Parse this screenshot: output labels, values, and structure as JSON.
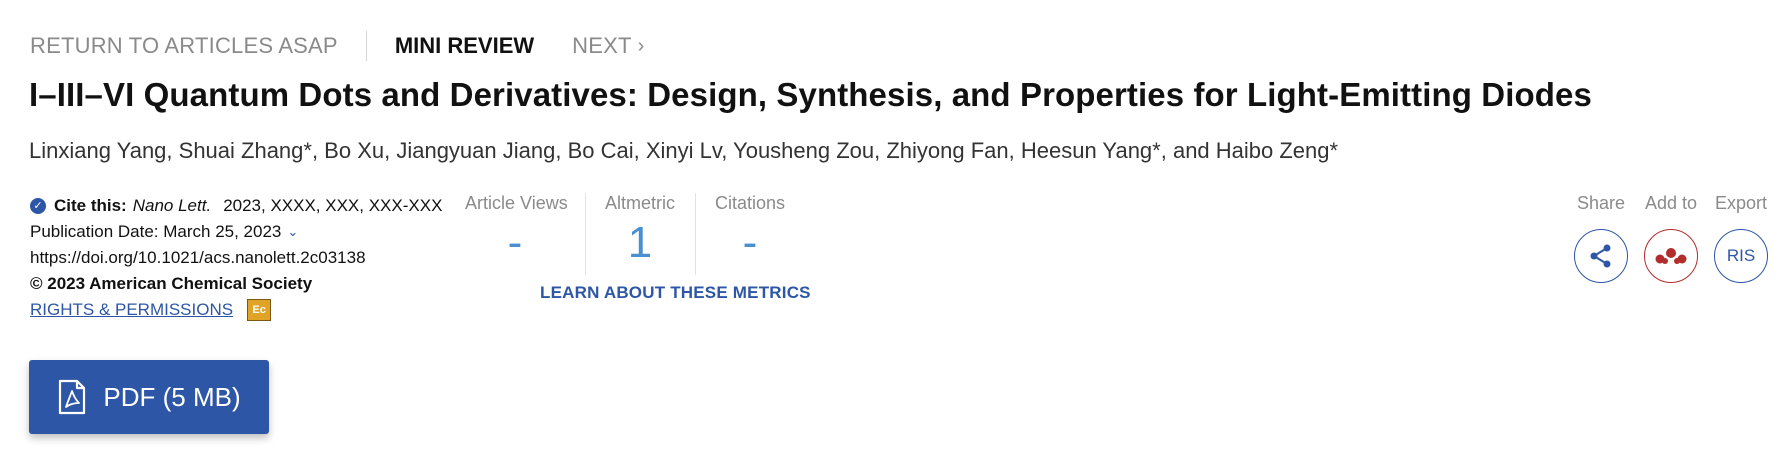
{
  "nav": {
    "return_label": "RETURN TO ARTICLES ASAP",
    "section_label": "MINI REVIEW",
    "next_label": "NEXT"
  },
  "article": {
    "title": "I–III–VI Quantum Dots and Derivatives: Design, Synthesis, and Properties for Light-Emitting Diodes",
    "authors": "Linxiang Yang, Shuai Zhang*, Bo Xu, Jiangyuan Jiang, Bo Cai, Xinyi Lv, Yousheng Zou, Zhiyong Fan, Heesun Yang*, and Haibo Zeng*"
  },
  "citation": {
    "cite_label": "Cite this:",
    "journal": "Nano Lett.",
    "ref": "2023, XXXX, XXX, XXX-XXX",
    "pub_date": "Publication Date: March 25, 2023",
    "doi": "https://doi.org/10.1021/acs.nanolett.2c03138",
    "copyright": "© 2023 American Chemical Society",
    "rights": "RIGHTS & PERMISSIONS",
    "badge": "Ec"
  },
  "metrics": {
    "views_label": "Article Views",
    "views_value": "-",
    "altmetric_label": "Altmetric",
    "altmetric_value": "1",
    "citations_label": "Citations",
    "citations_value": "-",
    "learn_label": "LEARN ABOUT THESE METRICS"
  },
  "actions": {
    "share_label": "Share",
    "add_label": "Add to",
    "export_label": "Export",
    "export_button": "RIS"
  },
  "pdf": {
    "label": "PDF (5 MB)"
  },
  "colors": {
    "accent": "#2d56a6",
    "metric_value": "#4a90d0",
    "mendeley": "#b32d2d"
  }
}
